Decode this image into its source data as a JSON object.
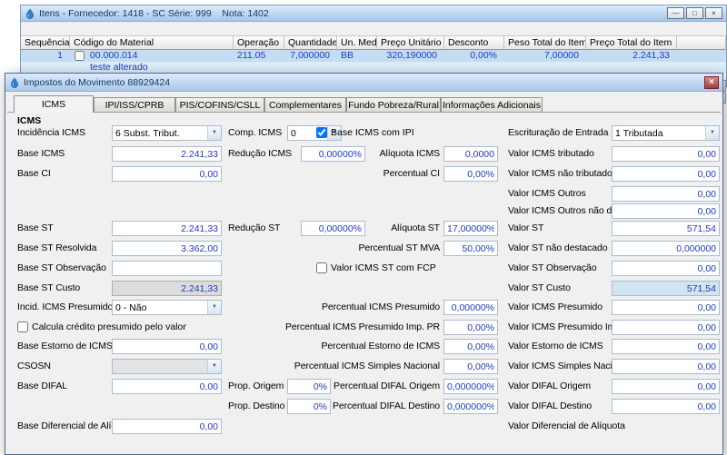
{
  "colors": {
    "titlebar_from": "#ddebfa",
    "titlebar_to": "#a9c7e8",
    "value_text": "#1b3cc0",
    "row_selection": "#c4ddf2",
    "field_border": "#a9bbd1",
    "highlight_field_bg": "#d2e3f2",
    "close_button": "#a03c3c"
  },
  "icons": {
    "app_icon": "water-droplet",
    "combo_arrow": "▼",
    "close_glyph": "×",
    "minimize_glyph": "—",
    "maximize_glyph": "□",
    "scroll_up": "▲"
  },
  "window": {
    "title": "Itens - Fornecedor: 1418 - SC Série: 999    Nota: 1402",
    "table": {
      "columns": [
        "Sequência",
        "Código do Material",
        "Operação",
        "Quantidade",
        "Un. Med.",
        "Preço Unitário",
        "Desconto",
        "Peso Total do Item",
        "Preço Total do Item"
      ],
      "rows": [
        {
          "seq": "1",
          "code": "00.000.014",
          "code2": "teste alterado",
          "op": "211.05",
          "qty": "7,000000",
          "um": "BB",
          "unit_price": "320,190000",
          "discount": "0,00%",
          "weight": "7,00000",
          "total": "2.241,33"
        }
      ]
    }
  },
  "dialog": {
    "title": "Impostos do Movimento 88929424",
    "section": "ICMS",
    "tabs": [
      {
        "label": "ICMS",
        "active": true
      },
      {
        "label": "IPI/ISS/CPRB",
        "active": false
      },
      {
        "label": "PIS/COFINS/CSLL",
        "active": false
      },
      {
        "label": "Complementares",
        "active": false
      },
      {
        "label": "Fundo Pobreza/Rural",
        "active": false
      },
      {
        "label": "Informações Adicionais",
        "active": false
      }
    ],
    "fields": {
      "incidencia_icms": {
        "label": "Incidência ICMS",
        "value": "6 Subst. Tribut."
      },
      "comp_icms": {
        "label": "Comp. ICMS",
        "value": "0"
      },
      "base_icms_com_ipi": {
        "label": "Base ICMS com IPI",
        "checked": true
      },
      "escrituracao_entrada": {
        "label": "Escrituração de Entrada",
        "value": "1 Tributada"
      },
      "base_icms": {
        "label": "Base ICMS",
        "value": "2.241,33"
      },
      "reducao_icms": {
        "label": "Redução ICMS",
        "value": "0,00000%"
      },
      "aliquota_icms": {
        "label": "Alíquota ICMS",
        "value": "0,0000"
      },
      "valor_icms_tributado": {
        "label": "Valor ICMS tributado",
        "value": "0,00"
      },
      "base_ci": {
        "label": "Base CI",
        "value": "0,00"
      },
      "percentual_ci": {
        "label": "Percentual CI",
        "value": "0,00%"
      },
      "valor_icms_nao_tributado": {
        "label": "Valor ICMS não tributado",
        "value": "0,00"
      },
      "valor_icms_outros": {
        "label": "Valor ICMS Outros",
        "value": "0,00"
      },
      "valor_icms_outros_nao_dest": {
        "label": "Valor ICMS Outros não dest.",
        "value": "0,00"
      },
      "base_st": {
        "label": "Base ST",
        "value": "2.241,33"
      },
      "reducao_st": {
        "label": "Redução ST",
        "value": "0,00000%"
      },
      "aliquota_st": {
        "label": "Alíquota ST",
        "value": "17,00000%"
      },
      "valor_st": {
        "label": "Valor ST",
        "value": "571,54"
      },
      "base_st_resolvida": {
        "label": "Base ST Resolvida",
        "value": "3.362,00"
      },
      "percentual_st_mva": {
        "label": "Percentual ST MVA",
        "value": "50,00%"
      },
      "valor_st_nao_destacado": {
        "label": "Valor ST não destacado",
        "value": "0,000000"
      },
      "base_st_observacao": {
        "label": "Base ST Observação",
        "value": ""
      },
      "valor_icms_st_com_fcp": {
        "label": "Valor ICMS ST com FCP",
        "checked": false
      },
      "valor_st_observacao": {
        "label": "Valor ST Observação",
        "value": "0,00"
      },
      "base_st_custo": {
        "label": "Base ST Custo",
        "value": "2.241,33"
      },
      "valor_st_custo": {
        "label": "Valor ST Custo",
        "value": "571,54"
      },
      "incid_icms_presumido": {
        "label": "Incid. ICMS Presumido",
        "value": "0 - Não"
      },
      "percentual_icms_presumido": {
        "label": "Percentual ICMS Presumido",
        "value": "0,00000%"
      },
      "valor_icms_presumido": {
        "label": "Valor ICMS Presumido",
        "value": "0,00"
      },
      "calcula_credito_presumido": {
        "label": "Calcula crédito presumido pelo valor",
        "checked": false
      },
      "percentual_icms_presumido_imp_pr": {
        "label": "Percentual ICMS Presumido Imp. PR",
        "value": "0,00%"
      },
      "valor_icms_presumido_imp_pr": {
        "label": "Valor ICMS Presumido Imp. PR",
        "value": "0,00"
      },
      "base_estorno_icms": {
        "label": "Base Estorno de ICMS",
        "value": "0,00"
      },
      "percentual_estorno_icms": {
        "label": "Percentual Estorno de ICMS",
        "value": "0,00%"
      },
      "valor_estorno_icms": {
        "label": "Valor Estorno de ICMS",
        "value": "0,00"
      },
      "csosn": {
        "label": "CSOSN",
        "value": ""
      },
      "percentual_icms_simples": {
        "label": "Percentual ICMS Simples Nacional",
        "value": "0,00%"
      },
      "valor_icms_simples": {
        "label": "Valor ICMS Simples Nacional",
        "value": "0,00"
      },
      "base_difal": {
        "label": "Base DIFAL",
        "value": "0,00"
      },
      "prop_origem": {
        "label": "Prop. Origem",
        "value": "0%"
      },
      "percentual_difal_origem": {
        "label": "Percentual DIFAL Origem",
        "value": "0,000000%"
      },
      "valor_difal_origem": {
        "label": "Valor DIFAL Origem",
        "value": "0,00"
      },
      "prop_destino": {
        "label": "Prop. Destino",
        "value": "0%"
      },
      "percentual_difal_destino": {
        "label": "Percentual DIFAL Destino",
        "value": "0,000000%"
      },
      "valor_difal_destino": {
        "label": "Valor DIFAL Destino",
        "value": "0,00"
      },
      "base_diferencial_aliq": {
        "label": "Base Diferencial de Alíq.",
        "value": "0,00"
      },
      "valor_diferencial_aliquota": {
        "label": "Valor Diferencial de Alíquota"
      }
    }
  }
}
